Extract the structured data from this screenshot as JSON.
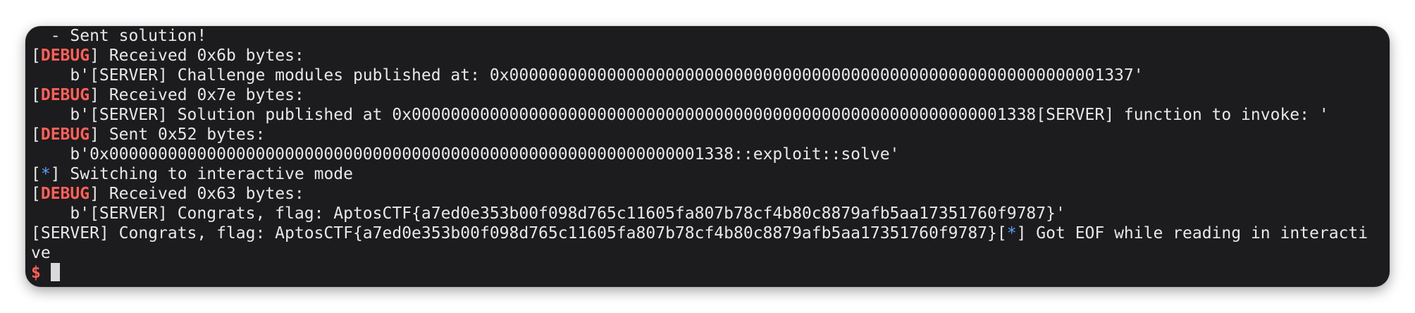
{
  "terminal": {
    "lines": [
      {
        "text": "  - Sent solution!"
      },
      {
        "open": "[",
        "tag": "DEBUG",
        "close": "]",
        "text": " Received 0x6b bytes:"
      },
      {
        "text": "    b'[SERVER] Challenge modules published at: 0x0000000000000000000000000000000000000000000000000000000000001337'"
      },
      {
        "open": "[",
        "tag": "DEBUG",
        "close": "]",
        "text": " Received 0x7e bytes:"
      },
      {
        "text": "    b'[SERVER] Solution published at 0x0000000000000000000000000000000000000000000000000000000000001338[SERVER] function to invoke: '"
      },
      {
        "open": "[",
        "tag": "DEBUG",
        "close": "]",
        "text": " Sent 0x52 bytes:"
      },
      {
        "text": "    b'0x0000000000000000000000000000000000000000000000000000000000001338::exploit::solve'"
      },
      {
        "open": "[",
        "star": "*",
        "close": "]",
        "text": " Switching to interactive mode"
      },
      {
        "open": "[",
        "tag": "DEBUG",
        "close": "]",
        "text": " Received 0x63 bytes:"
      },
      {
        "text": "    b'[SERVER] Congrats, flag: AptosCTF{a7ed0e353b00f098d765c11605fa807b78cf4b80c8879afb5aa17351760f9787}'"
      },
      {
        "text": "[SERVER] Congrats, flag: AptosCTF{a7ed0e353b00f098d765c11605fa807b78cf4b80c8879afb5aa17351760f9787}",
        "open": "[",
        "star": "*",
        "close": "]",
        "text2": " Got EOF while reading in interacti"
      },
      {
        "text": "ve"
      }
    ],
    "prompt": "$ "
  },
  "colors": {
    "background": "#1c1c1e",
    "text": "#e8e8e8",
    "debug": "#ff5f57",
    "info_star": "#5aa0ff"
  }
}
